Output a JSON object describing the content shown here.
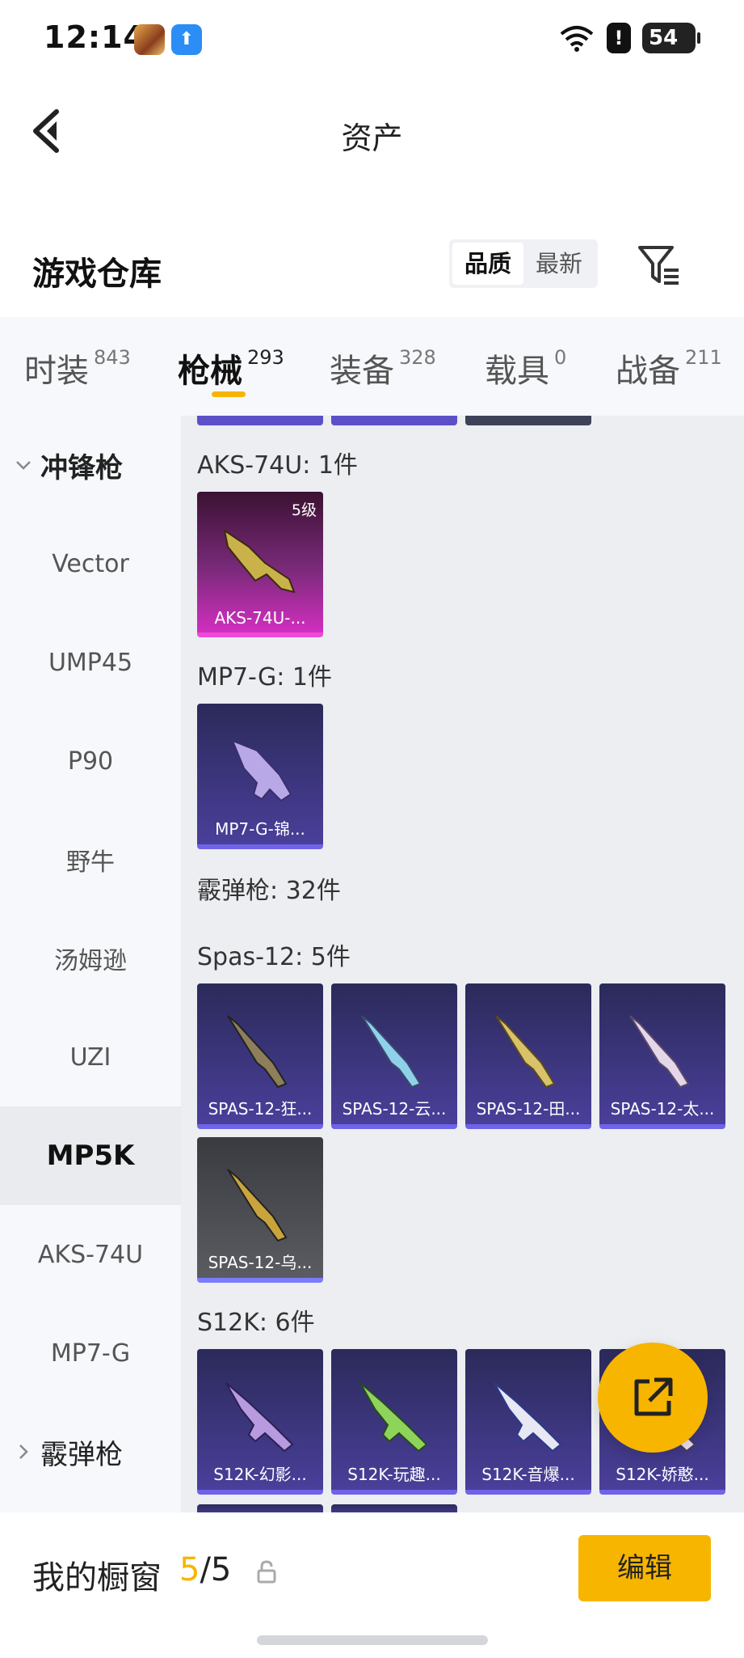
{
  "status_bar": {
    "time": "12:14",
    "battery": "54",
    "alert": "!"
  },
  "header": {
    "title": "资产"
  },
  "warehouse": {
    "title": "游戏仓库",
    "sort_options": [
      "品质",
      "最新"
    ],
    "active_sort": "品质"
  },
  "tabs": [
    {
      "label": "时装",
      "count": "843"
    },
    {
      "label": "枪械",
      "count": "293",
      "active": true
    },
    {
      "label": "装备",
      "count": "328"
    },
    {
      "label": "载具",
      "count": "0"
    },
    {
      "label": "战备",
      "count": "211"
    }
  ],
  "sidebar": {
    "group_expanded": "冲锋枪",
    "items": [
      "Vector",
      "UMP45",
      "P90",
      "野牛",
      "汤姆逊",
      "UZI",
      "MP5K",
      "AKS-74U",
      "MP7-G"
    ],
    "active_item": "MP5K",
    "group_collapsed": "霰弹枪"
  },
  "content": {
    "sections": [
      {
        "label": "AKS-74U: 1件",
        "items": [
          {
            "name": "AKS-74U-...",
            "level": "5级",
            "rarity": "legendary"
          }
        ]
      },
      {
        "label": "MP7-G: 1件",
        "items": [
          {
            "name": "MP7-G-锦...",
            "rarity": "epic"
          }
        ]
      },
      {
        "label": "霰弹枪: 32件"
      },
      {
        "label": "Spas-12: 5件",
        "items": [
          {
            "name": "SPAS-12-狂...",
            "rarity": "epic"
          },
          {
            "name": "SPAS-12-云...",
            "rarity": "epic"
          },
          {
            "name": "SPAS-12-田...",
            "rarity": "epic"
          },
          {
            "name": "SPAS-12-太...",
            "rarity": "epic"
          },
          {
            "name": "SPAS-12-乌...",
            "rarity": "common"
          }
        ]
      },
      {
        "label": "S12K: 6件",
        "items": [
          {
            "name": "S12K-幻影...",
            "rarity": "epic"
          },
          {
            "name": "S12K-玩趣...",
            "rarity": "epic"
          },
          {
            "name": "S12K-音爆...",
            "rarity": "epic"
          },
          {
            "name": "S12K-娇憨...",
            "rarity": "epic"
          }
        ]
      }
    ]
  },
  "bottom_bar": {
    "title": "我的橱窗",
    "count_current": "5",
    "count_total": "/5",
    "edit_label": "编辑"
  },
  "colors": {
    "accent": "#f7b500",
    "legendary": "#d12fc0",
    "epic": "#6f63e8",
    "common": "#5a5c62"
  }
}
